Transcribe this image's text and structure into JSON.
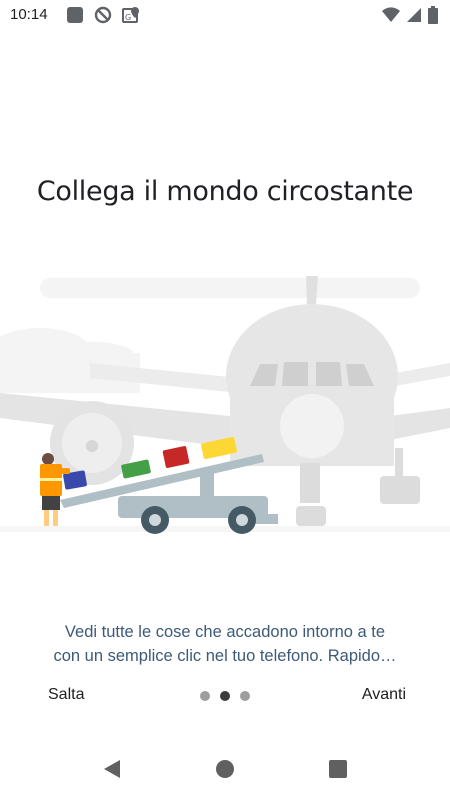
{
  "status_bar": {
    "time": "10:14",
    "left_icons": [
      "square-notification-icon",
      "no-entry-icon",
      "location-card-icon"
    ],
    "right_icons": [
      "wifi-icon",
      "signal-icon",
      "battery-icon"
    ]
  },
  "onboarding": {
    "title": "Collega il mondo circostante",
    "description_line1": "Vedi tutte le cose che accadono intorno a te",
    "description_line2": "con un semplice clic nel tuo telefono. Rapido…",
    "skip_label": "Salta",
    "next_label": "Avanti",
    "page_indicator": {
      "total": 3,
      "current": 2
    }
  },
  "navigation_bar": {
    "icons": [
      "back-triangle-icon",
      "home-circle-icon",
      "recents-square-icon"
    ]
  },
  "colors": {
    "description_text": "#3c5a78",
    "plane_gray": "#e6e6e6",
    "truck_gray": "#b0bec5",
    "bag_green": "#43a047",
    "bag_red": "#c62828",
    "bag_yellow": "#fdd835",
    "bag_blue": "#3949ab",
    "vest_orange": "#ff9800"
  }
}
